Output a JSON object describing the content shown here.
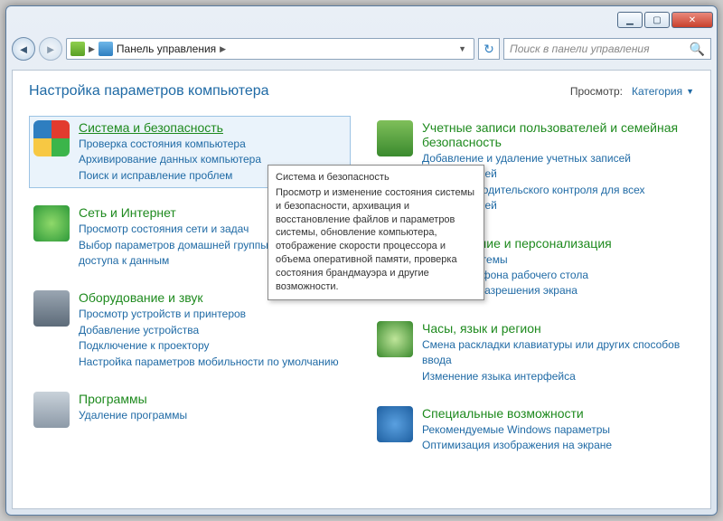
{
  "nav": {
    "breadcrumb": "Панель управления",
    "search_placeholder": "Поиск в панели управления"
  },
  "header": {
    "title": "Настройка параметров компьютера",
    "view_label": "Просмотр:",
    "view_value": "Категория"
  },
  "left": [
    {
      "id": "system-security",
      "icon": "ic-shield",
      "title": "Система и безопасность",
      "links": [
        "Проверка состояния компьютера",
        "Архивирование данных компьютера",
        "Поиск и исправление проблем"
      ],
      "selected": true
    },
    {
      "id": "network",
      "icon": "ic-net",
      "title": "Сеть и Интернет",
      "links": [
        "Просмотр состояния сети и задач",
        "Выбор параметров домашней группы и общего доступа к данным"
      ]
    },
    {
      "id": "hardware",
      "icon": "ic-hw",
      "title": "Оборудование и звук",
      "links": [
        "Просмотр устройств и принтеров",
        "Добавление устройства",
        "Подключение к проектору",
        "Настройка параметров мобильности по умолчанию"
      ]
    },
    {
      "id": "programs",
      "icon": "ic-prog",
      "title": "Программы",
      "links": [
        "Удаление программы"
      ]
    }
  ],
  "right": [
    {
      "id": "users",
      "icon": "ic-users",
      "title": "Учетные записи пользователей и семейная безопасность",
      "links": [
        "Добавление и удаление учетных записей пользователей",
        "Установка родительского контроля для всех пользователей"
      ]
    },
    {
      "id": "appearance",
      "icon": "ic-pers",
      "title": "Оформление и персонализация",
      "links": [
        "Изменение темы",
        "Изменение фона рабочего стола",
        "Настройка разрешения экрана"
      ]
    },
    {
      "id": "clock",
      "icon": "ic-clock",
      "title": "Часы, язык и регион",
      "links": [
        "Смена раскладки клавиатуры или других способов ввода",
        "Изменение языка интерфейса"
      ]
    },
    {
      "id": "access",
      "icon": "ic-acc",
      "title": "Специальные возможности",
      "links": [
        "Рекомендуемые Windows параметры",
        "Оптимизация изображения на экране"
      ]
    }
  ],
  "tooltip": {
    "title": "Система и безопасность",
    "body": "Просмотр и изменение состояния системы и безопасности, архивация и восстановление файлов и параметров системы, обновление компьютера, отображение скорости процессора и объема оперативной памяти, проверка состояния брандмауэра и другие возможности."
  }
}
